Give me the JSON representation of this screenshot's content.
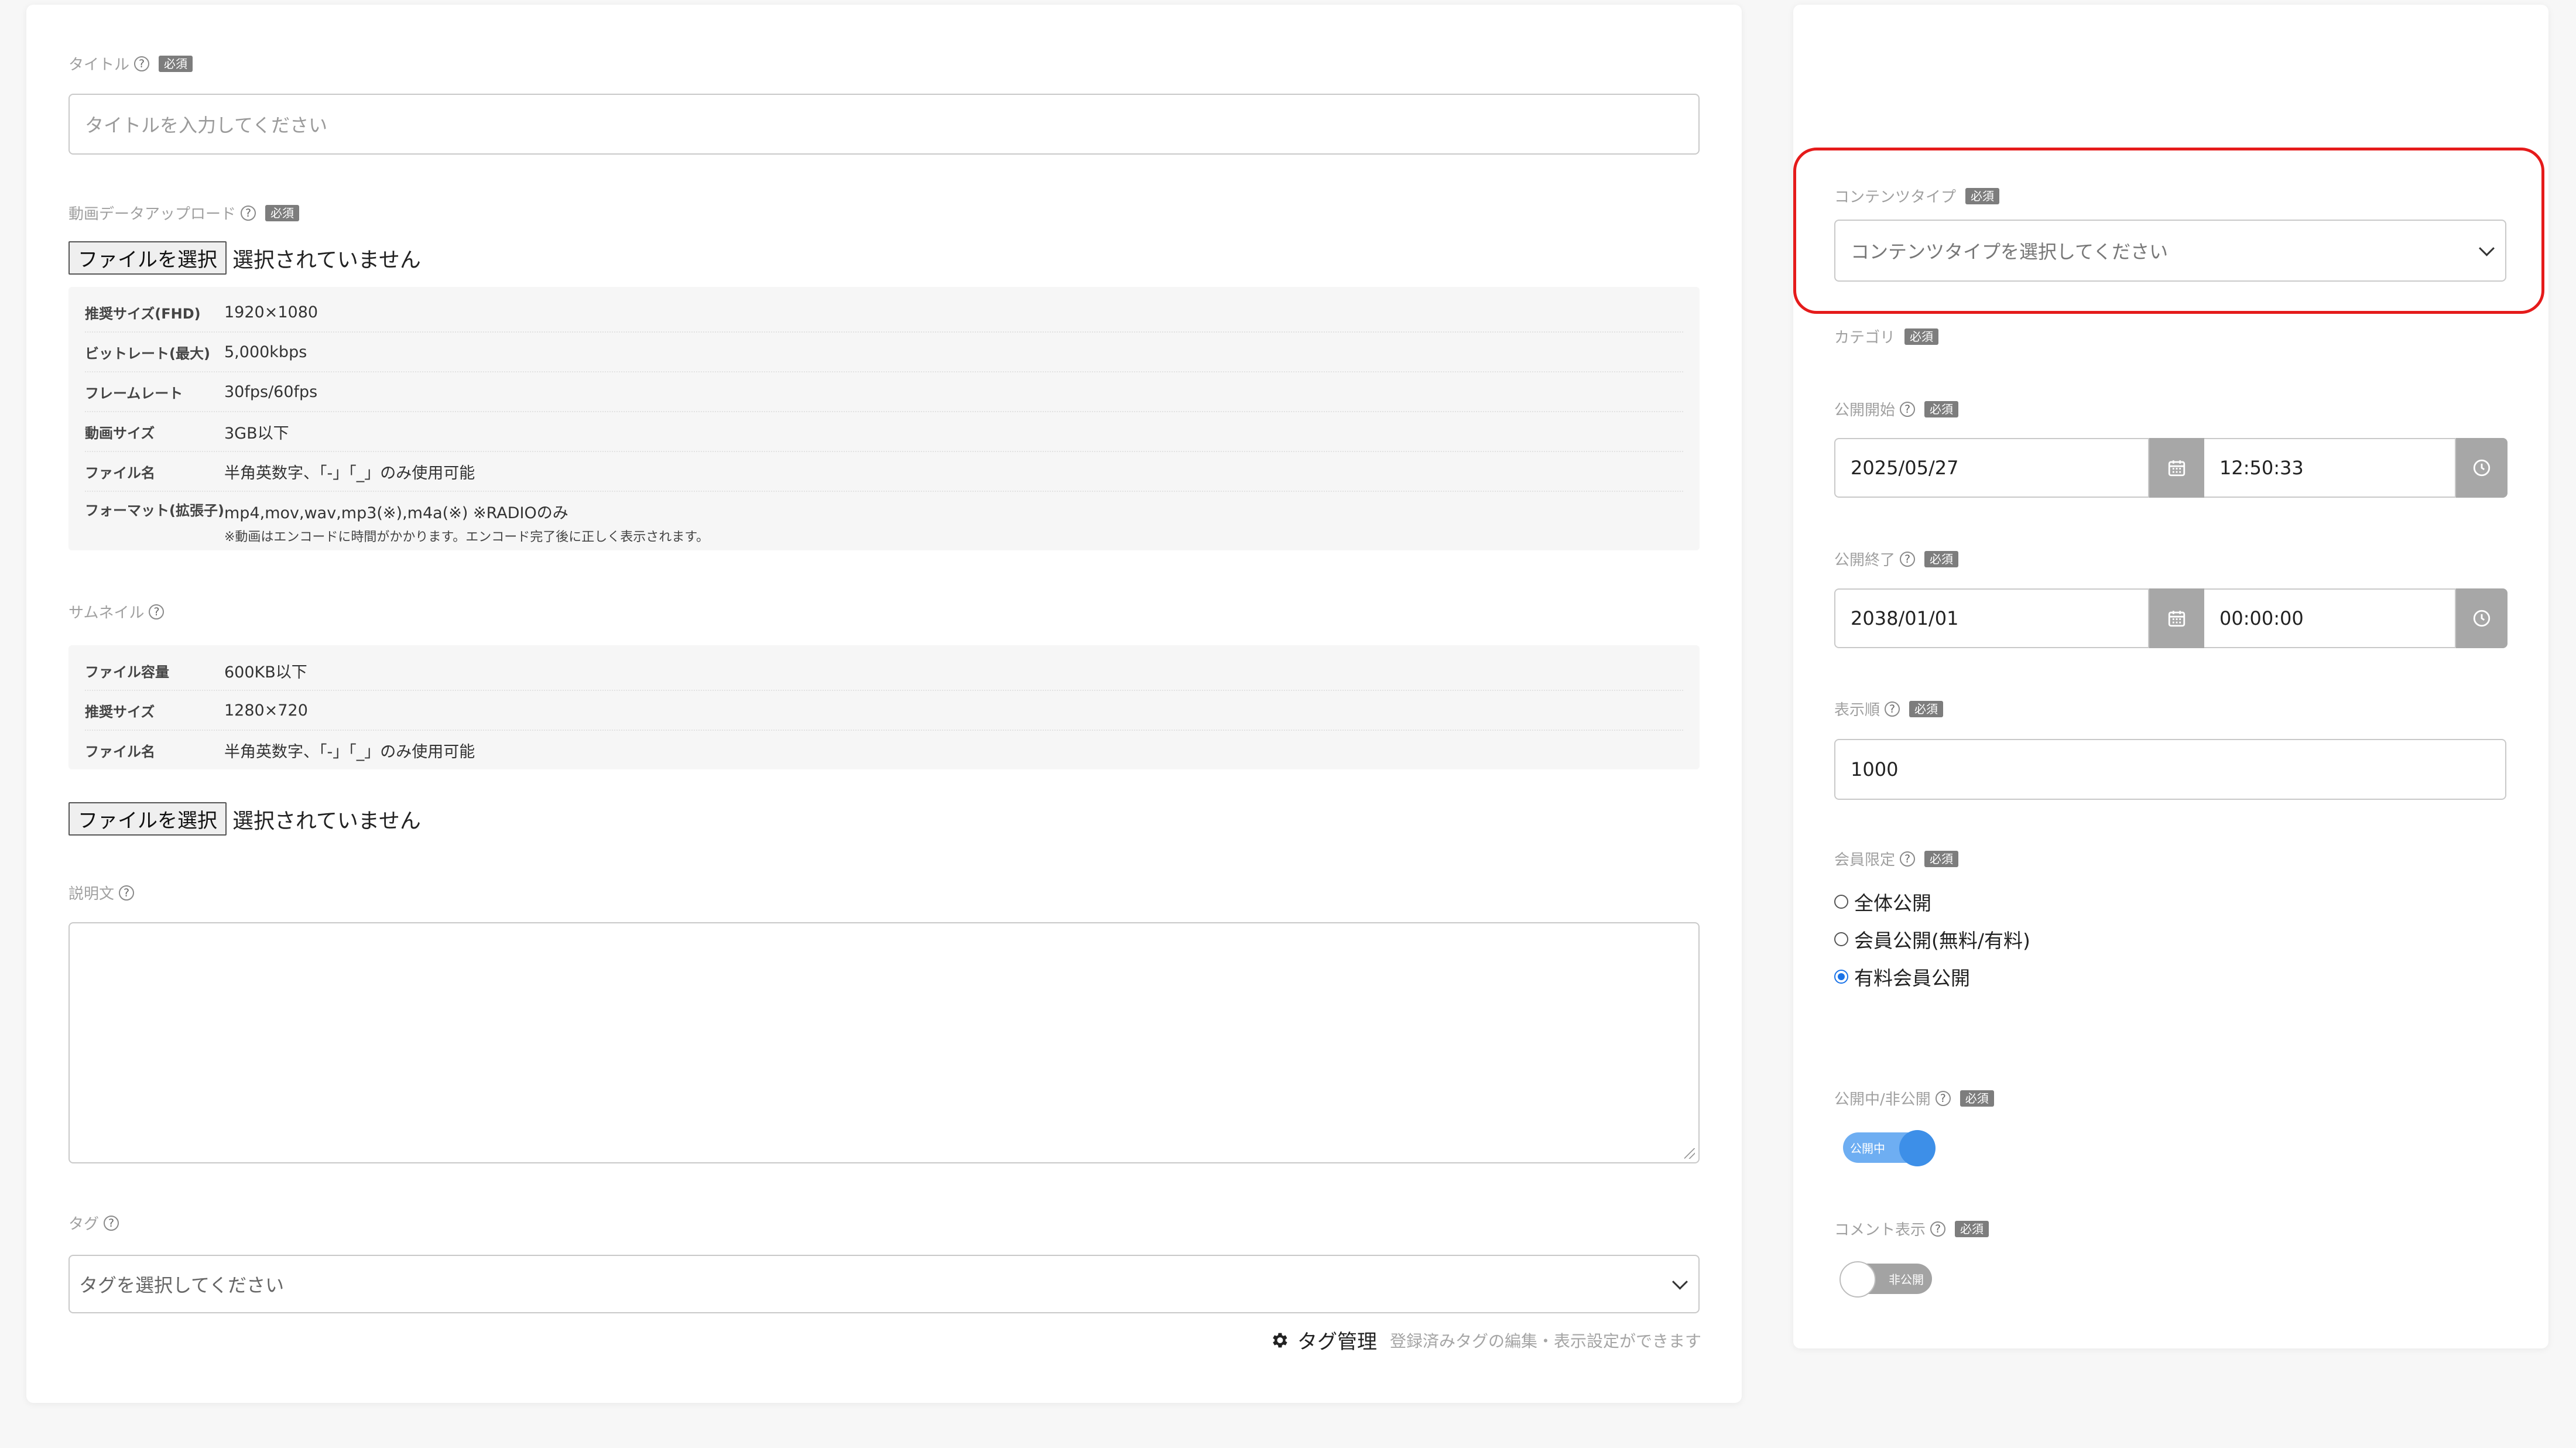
{
  "form": {
    "title": {
      "label": "タイトル",
      "required": "必須",
      "placeholder": "タイトルを入力してください"
    },
    "video": {
      "label": "動画データアップロード",
      "required": "必須",
      "file_button": "ファイルを選択",
      "file_status": "選択されていません",
      "specs": [
        {
          "key": "推奨サイズ(FHD)",
          "value": "1920×1080"
        },
        {
          "key": "ビットレート(最大)",
          "value": "5,000kbps"
        },
        {
          "key": "フレームレート",
          "value": "30fps/60fps"
        },
        {
          "key": "動画サイズ",
          "value": "3GB以下"
        },
        {
          "key": "ファイル名",
          "value": "半角英数字、「-」「_」のみ使用可能"
        },
        {
          "key": "フォーマット(拡張子)",
          "value": "mp4,mov,wav,mp3(※),m4a(※) ※RADIOのみ",
          "note": "※動画はエンコードに時間がかかります。エンコード完了後に正しく表示されます。"
        }
      ]
    },
    "thumbnail": {
      "label": "サムネイル",
      "specs": [
        {
          "key": "ファイル容量",
          "value": "600KB以下"
        },
        {
          "key": "推奨サイズ",
          "value": "1280×720"
        },
        {
          "key": "ファイル名",
          "value": "半角英数字、「-」「_」のみ使用可能"
        }
      ],
      "file_button": "ファイルを選択",
      "file_status": "選択されていません"
    },
    "description": {
      "label": "説明文",
      "value": ""
    },
    "tags": {
      "label": "タグ",
      "placeholder": "タグを選択してください",
      "manage_label": "タグ管理",
      "manage_hint": "登録済みタグの編集・表示設定ができます"
    }
  },
  "sidebar": {
    "content_type": {
      "label": "コンテンツタイプ",
      "required": "必須",
      "placeholder": "コンテンツタイプを選択してください"
    },
    "category": {
      "label": "カテゴリ",
      "required": "必須"
    },
    "publish_start": {
      "label": "公開開始",
      "required": "必須",
      "date": "2025/05/27",
      "time": "12:50:33"
    },
    "publish_end": {
      "label": "公開終了",
      "required": "必須",
      "date": "2038/01/01",
      "time": "00:00:00"
    },
    "display_order": {
      "label": "表示順",
      "required": "必須",
      "value": "1000"
    },
    "membership": {
      "label": "会員限定",
      "required": "必須",
      "options": [
        "全体公開",
        "会員公開(無料/有料)",
        "有料会員公開"
      ],
      "selected": "有料会員公開"
    },
    "visibility": {
      "label": "公開中/非公開",
      "required": "必須",
      "toggle_text": "公開中",
      "on": true
    },
    "comments": {
      "label": "コメント表示",
      "required": "必須",
      "toggle_text": "非公開",
      "on": false
    }
  },
  "colors": {
    "highlight": "#e51b1b",
    "toggle_on": "#6eaef2",
    "toggle_knob": "#3d8fe8",
    "radio_selected": "#1a73e8"
  }
}
